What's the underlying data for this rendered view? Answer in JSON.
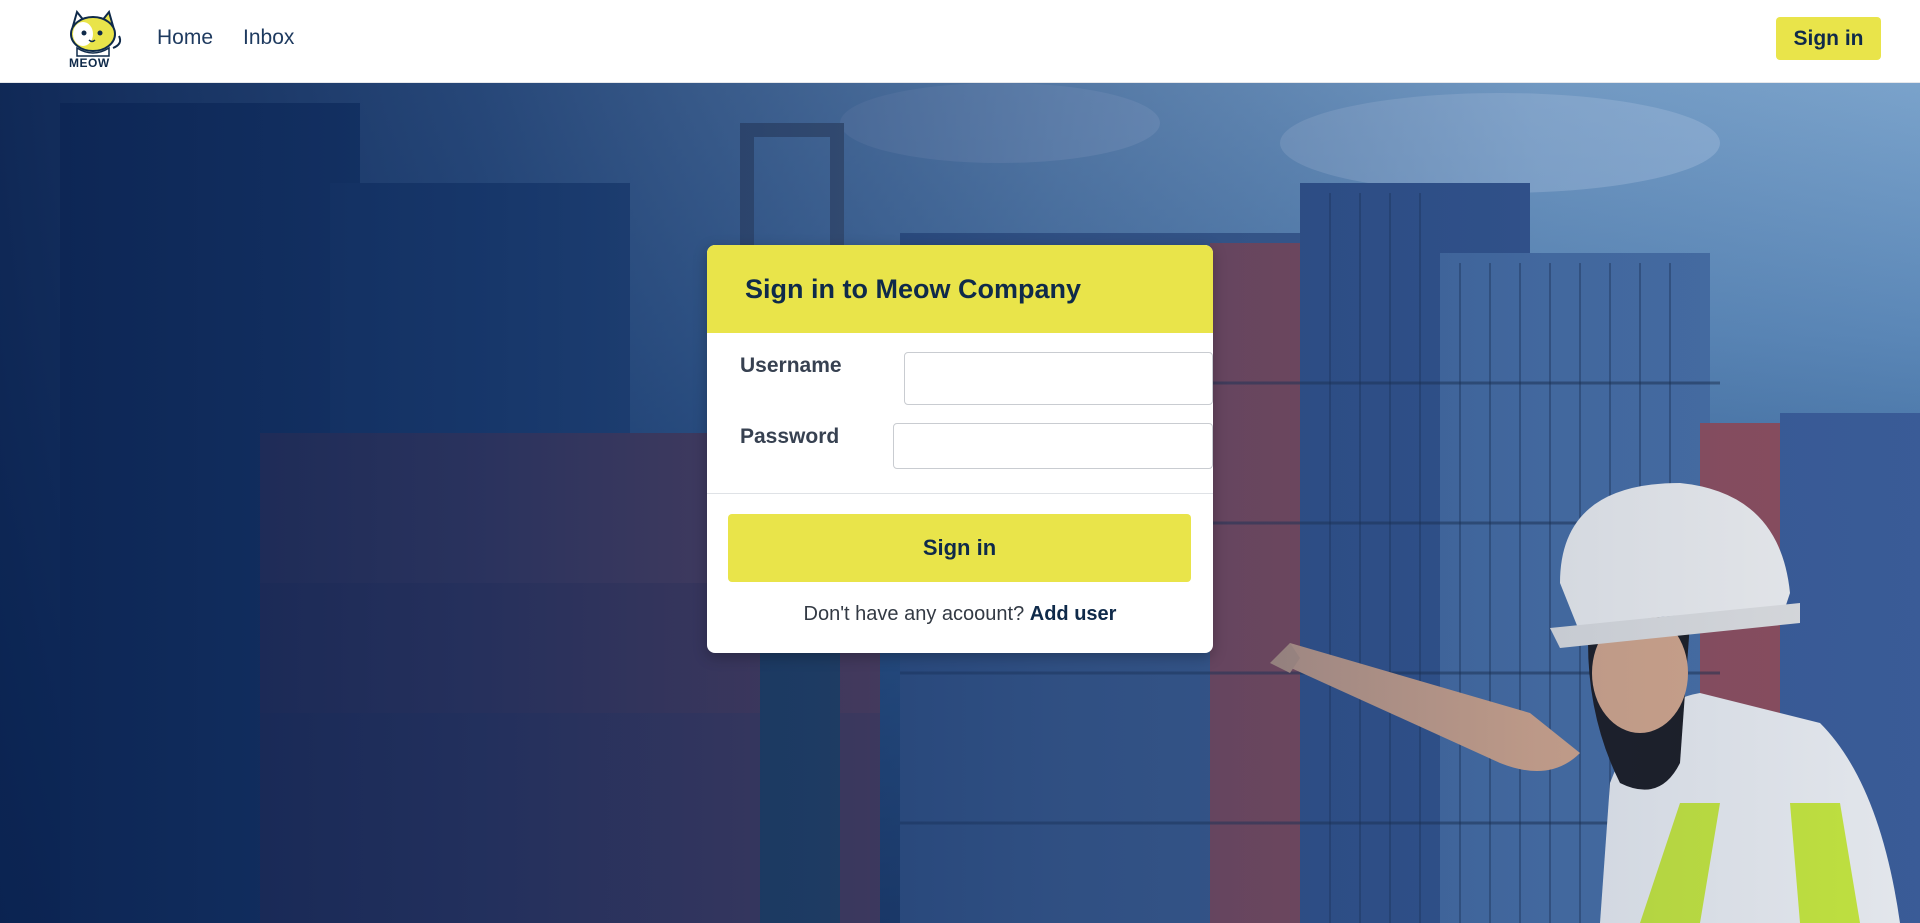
{
  "nav": {
    "logo_text": "MEOW",
    "links": [
      {
        "label": "Home"
      },
      {
        "label": "Inbox"
      }
    ],
    "signin_label": "Sign in"
  },
  "card": {
    "title": "Sign in to Meow Company",
    "username_label": "Username",
    "username_value": "",
    "password_label": "Password",
    "password_value": "",
    "signin_label": "Sign in",
    "signup_prompt": "Don't have any acoount?",
    "add_user_label": "Add user"
  },
  "colors": {
    "accent": "#e9e44a",
    "brand_dark": "#0f2a4a",
    "hero_overlay": "#0a2250"
  },
  "icons": {
    "logo": "cat-logo-icon"
  }
}
